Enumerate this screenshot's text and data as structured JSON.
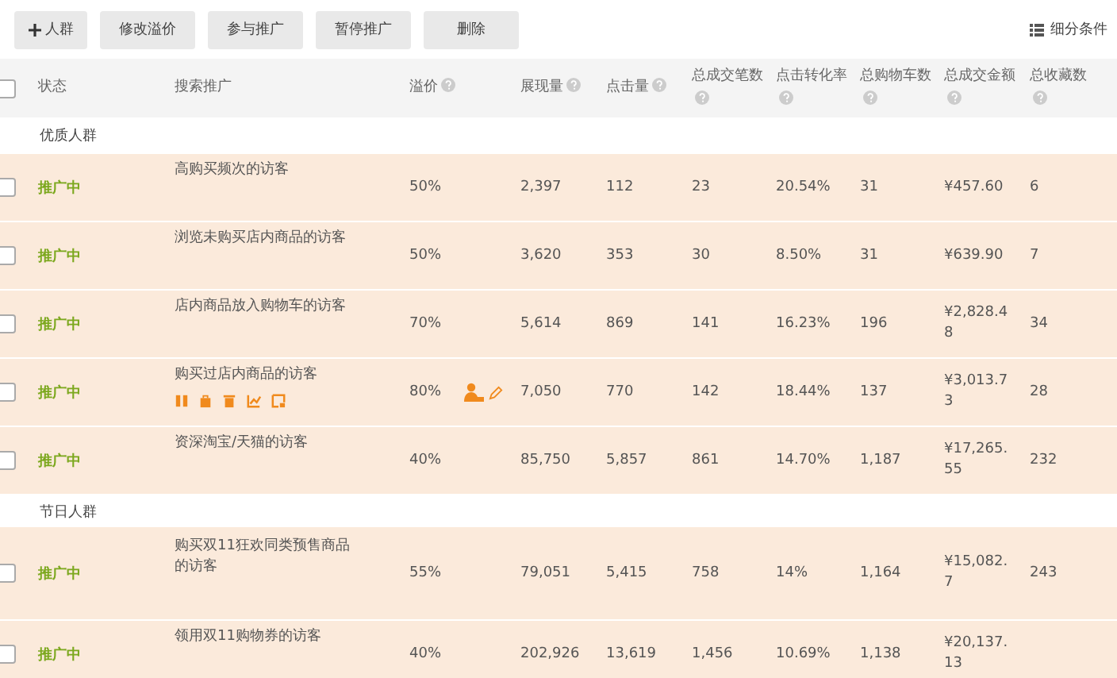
{
  "toolbar": {
    "buttons": [
      {
        "label": "人群",
        "kind": "add"
      },
      {
        "label": "修改溢价",
        "kind": "plain"
      },
      {
        "label": "参与推广",
        "kind": "plain"
      },
      {
        "label": "暂停推广",
        "kind": "plain"
      },
      {
        "label": "删除",
        "kind": "plain"
      }
    ],
    "filter_link": "细分条件"
  },
  "table": {
    "select_all_checked": false,
    "columns": [
      {
        "label": "状态",
        "help": false
      },
      {
        "label": "搜索推广",
        "help": false
      },
      {
        "label": "溢价",
        "help": true
      },
      {
        "label": "展现量",
        "help": true
      },
      {
        "label": "点击量",
        "help": true
      },
      {
        "label": "总成交笔数",
        "help": true
      },
      {
        "label": "点击转化率",
        "help": true
      },
      {
        "label": "总购物车数",
        "help": true
      },
      {
        "label": "总成交金额",
        "help": true
      },
      {
        "label": "总收藏数",
        "help": true
      }
    ],
    "groups": [
      {
        "name": "优质人群",
        "rows": [
          {
            "checked": false,
            "status": "推广中",
            "name": "高购买频次的访客",
            "actions": false,
            "bid": "50%",
            "impressions": "2,397",
            "clicks": "112",
            "orders": "23",
            "conversion": "20.54%",
            "carts": "31",
            "amount": "¥457.60",
            "favorites": "6"
          },
          {
            "checked": false,
            "status": "推广中",
            "name": "浏览未购买店内商品的访客",
            "actions": false,
            "bid": "50%",
            "impressions": "3,620",
            "clicks": "353",
            "orders": "30",
            "conversion": "8.50%",
            "carts": "31",
            "amount": "¥639.90",
            "favorites": "7"
          },
          {
            "checked": false,
            "status": "推广中",
            "name": "店内商品放入购物车的访客",
            "actions": false,
            "bid": "70%",
            "impressions": "5,614",
            "clicks": "869",
            "orders": "141",
            "conversion": "16.23%",
            "carts": "196",
            "amount": "¥2,828.48",
            "favorites": "34"
          },
          {
            "checked": false,
            "status": "推广中",
            "name": "购买过店内商品的访客",
            "actions": true,
            "bid": "80%",
            "impressions": "7,050",
            "clicks": "770",
            "orders": "142",
            "conversion": "18.44%",
            "carts": "137",
            "amount": "¥3,013.73",
            "favorites": "28"
          },
          {
            "checked": false,
            "status": "推广中",
            "name": "资深淘宝/天猫的访客",
            "actions": false,
            "bid": "40%",
            "impressions": "85,750",
            "clicks": "5,857",
            "orders": "861",
            "conversion": "14.70%",
            "carts": "1,187",
            "amount": "¥17,265.55",
            "favorites": "232"
          }
        ]
      },
      {
        "name": "节日人群",
        "rows": [
          {
            "checked": false,
            "status": "推广中",
            "name": "购买双11狂欢同类预售商品的访客",
            "actions": false,
            "bid": "55%",
            "impressions": "79,051",
            "clicks": "5,415",
            "orders": "758",
            "conversion": "14%",
            "carts": "1,164",
            "amount": "¥15,082.7",
            "favorites": "243"
          },
          {
            "checked": false,
            "status": "推广中",
            "name": "领用双11购物券的访客",
            "actions": false,
            "bid": "40%",
            "impressions": "202,926",
            "clicks": "13,619",
            "orders": "1,456",
            "conversion": "10.69%",
            "carts": "1,138",
            "amount": "¥20,137.13"
          }
        ]
      }
    ]
  }
}
